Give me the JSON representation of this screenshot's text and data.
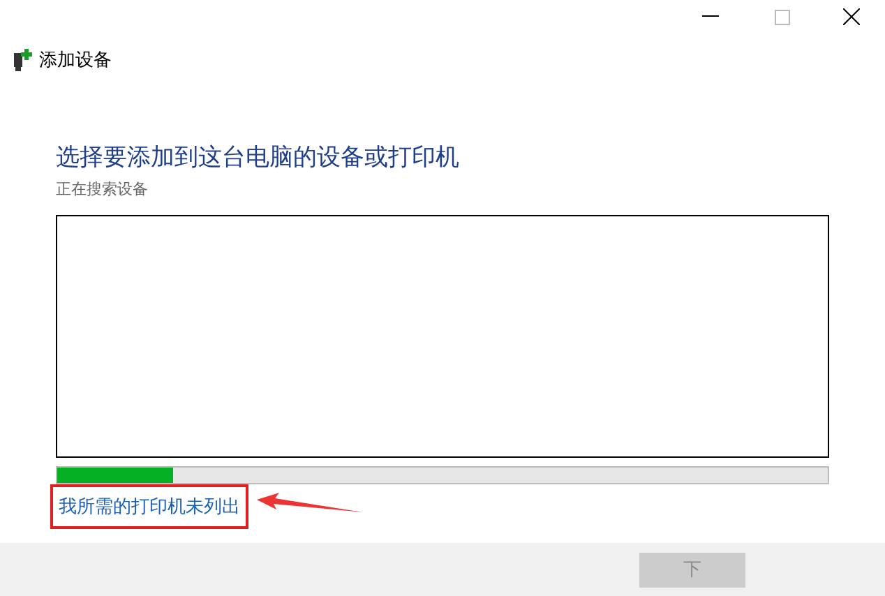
{
  "window": {
    "title": "添加设备"
  },
  "heading": "选择要添加到这台电脑的设备或打印机",
  "status": "正在搜索设备",
  "progress": {
    "level": 0.15
  },
  "link": {
    "label": "我所需的打印机未列出",
    "annotated": true
  },
  "buttons": [
    {
      "label": "下",
      "disabled": true
    }
  ]
}
